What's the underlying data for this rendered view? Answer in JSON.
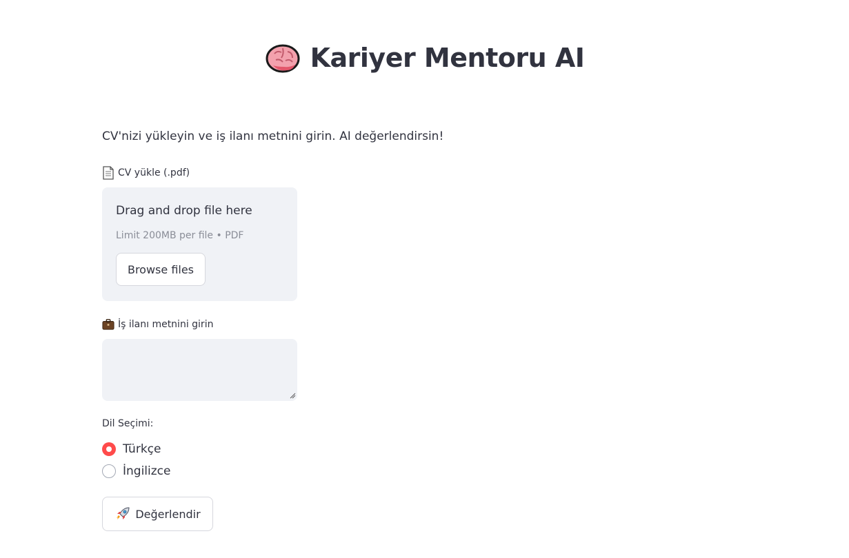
{
  "header": {
    "icon": "brain-icon",
    "title": "Kariyer Mentoru AI"
  },
  "intro_text": "CV'nizi yükleyin ve iş ilanı metnini girin. AI değerlendirsin!",
  "cv_upload": {
    "icon": "document-icon",
    "label": "CV yükle (.pdf)",
    "dropzone_title": "Drag and drop file here",
    "limit_text": "Limit 200MB per file • PDF",
    "browse_label": "Browse files"
  },
  "job_post": {
    "icon": "briefcase-icon",
    "label": "İş ilanı metnini girin",
    "value": "",
    "placeholder": ""
  },
  "language": {
    "label": "Dil Seçimi:",
    "options": [
      {
        "label": "Türkçe",
        "selected": true
      },
      {
        "label": "İngilizce",
        "selected": false
      }
    ]
  },
  "evaluate_button": {
    "icon": "rocket-icon",
    "label": "Değerlendir"
  },
  "colors": {
    "accent": "#ff4b4b",
    "text": "#31333f",
    "input_bg": "#f0f2f6",
    "muted_text": "#8a8d97"
  }
}
